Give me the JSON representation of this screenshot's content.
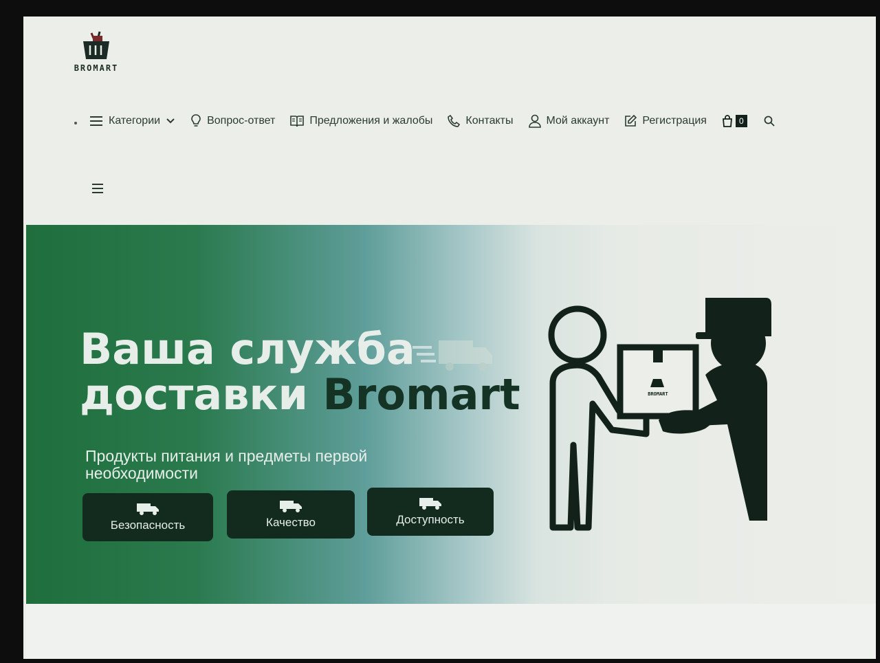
{
  "brand": {
    "logo_text": "BROMART",
    "logo_icon": "basket-icon"
  },
  "nav": {
    "items": [
      {
        "label": "Категории",
        "icon": "menu-icon",
        "has_dropdown": true
      },
      {
        "label": "Вопрос-ответ",
        "icon": "lightbulb-icon"
      },
      {
        "label": "Предложения и жалобы",
        "icon": "book-icon"
      },
      {
        "label": "Контакты",
        "icon": "phone-icon"
      },
      {
        "label": "Мой аккаунт",
        "icon": "user-icon"
      },
      {
        "label": "Регистрация",
        "icon": "edit-icon"
      }
    ],
    "cart_count": "0"
  },
  "hero": {
    "title_line1": "Ваша служба",
    "title_line2_prefix": "доставки",
    "title_brand": "Bromart",
    "subtitle": "Продукты питания и предметы первой необходимости",
    "features": [
      {
        "label": "Безопасность",
        "icon": "truck-icon"
      },
      {
        "label": "Качество",
        "icon": "truck-icon"
      },
      {
        "label": "Доступность",
        "icon": "truck-icon"
      }
    ],
    "illustration_box_text": "BROMART"
  },
  "colors": {
    "dark_green": "#132a1e",
    "hero_green": "#1f6e3c",
    "text_dark": "#2a3a33",
    "background": "#ecefe9"
  }
}
